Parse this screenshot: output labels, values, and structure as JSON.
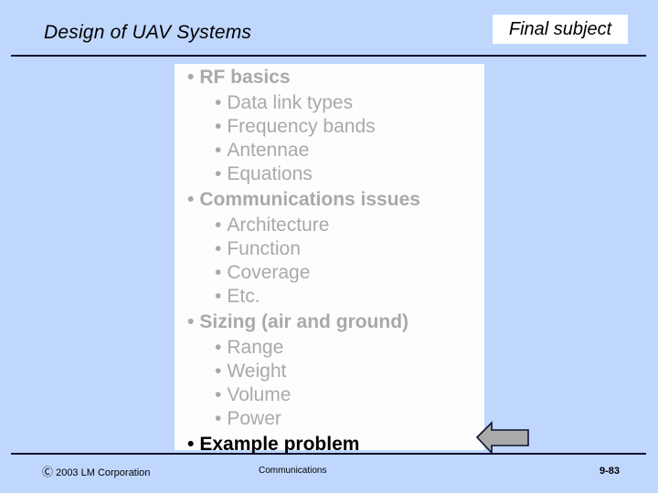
{
  "slide": {
    "background_color": "#bfd7fd",
    "title": "Design of UAV Systems",
    "subject_tag": "Final subject"
  },
  "content": {
    "panel_background": "#fdfdfd",
    "dim_color": "#a9a9a9",
    "current_color": "#000000",
    "bullet_glyph": "•",
    "items": [
      {
        "level": 1,
        "label": "RF basics",
        "state": "dim"
      },
      {
        "level": 2,
        "label": "Data link types",
        "state": "dim"
      },
      {
        "level": 2,
        "label": "Frequency bands",
        "state": "dim"
      },
      {
        "level": 2,
        "label": "Antennae",
        "state": "dim"
      },
      {
        "level": 2,
        "label": "Equations",
        "state": "dim"
      },
      {
        "level": 1,
        "label": "Communications issues",
        "state": "dim"
      },
      {
        "level": 2,
        "label": "Architecture",
        "state": "dim"
      },
      {
        "level": 2,
        "label": "Function",
        "state": "dim"
      },
      {
        "level": 2,
        "label": "Coverage",
        "state": "dim"
      },
      {
        "level": 2,
        "label": "Etc.",
        "state": "dim"
      },
      {
        "level": 1,
        "label": "Sizing (air and ground)",
        "state": "dim"
      },
      {
        "level": 2,
        "label": "Range",
        "state": "dim"
      },
      {
        "level": 2,
        "label": "Weight",
        "state": "dim"
      },
      {
        "level": 2,
        "label": "Volume",
        "state": "dim"
      },
      {
        "level": 2,
        "label": "Power",
        "state": "dim"
      },
      {
        "level": 1,
        "label": "Example problem",
        "state": "current"
      }
    ]
  },
  "pointer": {
    "icon": "arrow-left-icon",
    "fill_color": "#aaaaaa",
    "outline_color": "#101030"
  },
  "footer": {
    "copyright_mark": "Ⓒ",
    "copyright": "2003 LM Corporation",
    "topic": "Communications",
    "page_number": "9-83"
  }
}
